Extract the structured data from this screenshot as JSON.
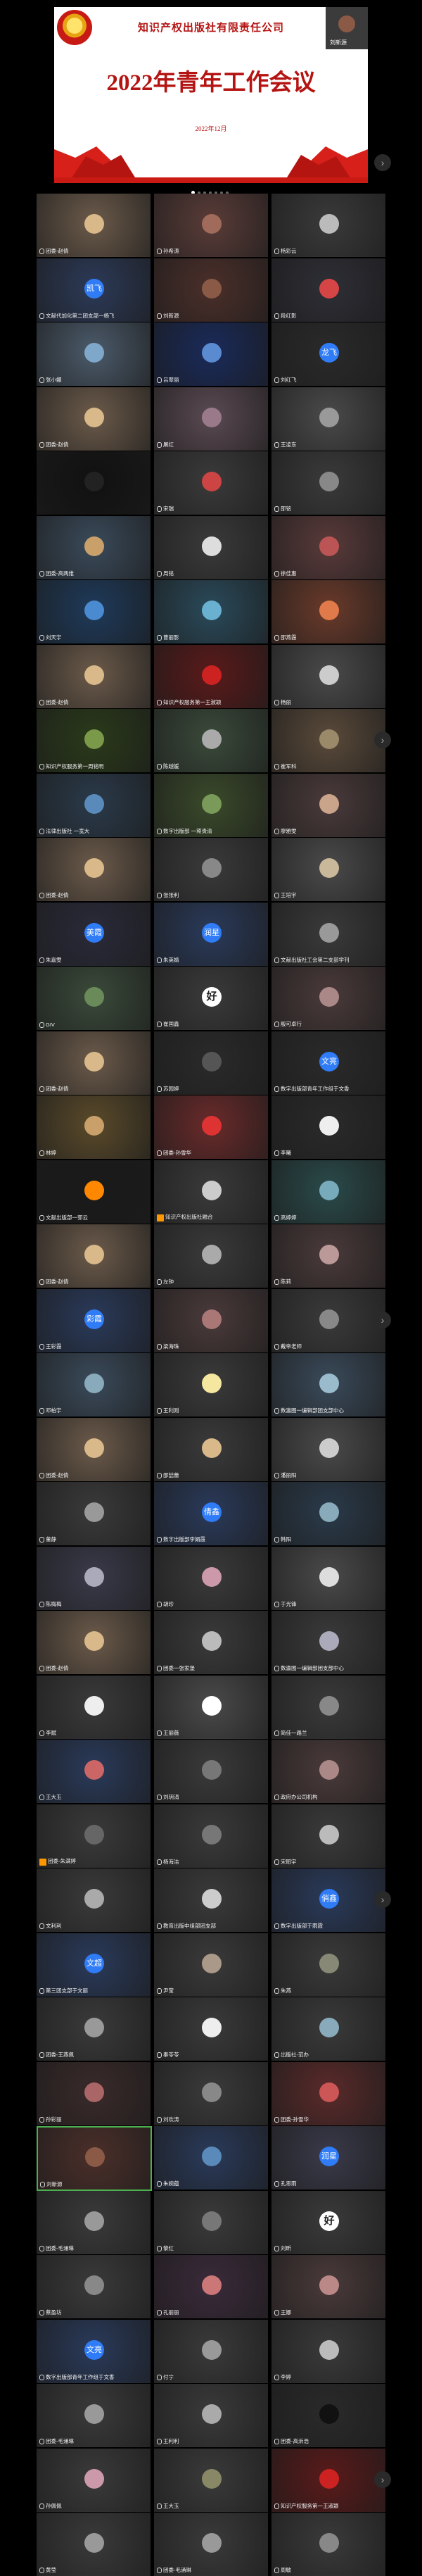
{
  "shared_screen": {
    "org": "知识产权出版社有限责任公司",
    "title": "2022年青年工作会议",
    "date": "2022年12月",
    "self_name": "刘新源"
  },
  "nav_arrow": "›",
  "tiles": [
    {
      "name": "团委-赵倩",
      "color": "#6b5a4a",
      "av": "#d9b98a"
    },
    {
      "name": "孙希涛",
      "color": "#5a3c38",
      "av": "#a06b5a"
    },
    {
      "name": "杨彩云",
      "color": "#3a3a3a",
      "av": "#bbb"
    },
    {
      "name": "文献代加化第二团支部一杨飞",
      "color": "#2c3a58",
      "badge": "凯飞"
    },
    {
      "name": "刘新源",
      "color": "#4b2f2a",
      "av": "#8a5a46"
    },
    {
      "name": "段红影",
      "color": "#2e2e36",
      "av": "#d64545"
    },
    {
      "name": "张小娜",
      "color": "#4b5a6a",
      "av": "#7fa7c9"
    },
    {
      "name": "吕翠丽",
      "color": "#1a2a5a",
      "av": "#5a8ad0"
    },
    {
      "name": "刘红飞",
      "color": "#2a2a2a",
      "badge": "龙飞"
    },
    {
      "name": "团委-赵倩",
      "color": "#6b5a4a",
      "av": "#d9b98a"
    },
    {
      "name": "屠红",
      "color": "#5a4a52",
      "av": "#9a7a8a"
    },
    {
      "name": "王凌东",
      "color": "#4a4a4a",
      "av": "#999"
    },
    {
      "name": "",
      "color": "#111",
      "av": "#222"
    },
    {
      "name": "宋瑞",
      "color": "#3a3a3a",
      "av": "#c44"
    },
    {
      "name": "邵铭",
      "color": "#3a3a3a",
      "av": "#888"
    },
    {
      "name": "团委-高两维",
      "color": "#3a4a5a",
      "av": "#c9a06a"
    },
    {
      "name": "周铭",
      "color": "#3a3a3a",
      "av": "#ddd"
    },
    {
      "name": "徐佳惠",
      "color": "#5a3a3a",
      "av": "#b55"
    },
    {
      "name": "刘天宇",
      "color": "#1e3a5a",
      "av": "#4a8ad0"
    },
    {
      "name": "曹丽影",
      "color": "#2a4a5a",
      "av": "#6ab0d0"
    },
    {
      "name": "邵燕霞",
      "color": "#6a3a2a",
      "av": "#e07a4a"
    },
    {
      "name": "团委-赵倩",
      "color": "#6b5a4a",
      "av": "#d9b98a"
    },
    {
      "name": "知识产权服务第一王淑颖",
      "color": "#5a1a1a",
      "av": "#c22"
    },
    {
      "name": "杨丽",
      "color": "#4a4a4a",
      "av": "#ccc"
    },
    {
      "name": "知识产权服务第一周铭明",
      "color": "#2a3a1a",
      "av": "#7a9a4a"
    },
    {
      "name": "陈越媛",
      "color": "#3a4a3a",
      "av": "#aaa"
    },
    {
      "name": "崔军科",
      "color": "#5a4a3a",
      "av": "#9a8a6a"
    },
    {
      "name": "法律出版社 一宽大",
      "color": "#2a3a4a",
      "av": "#5a8aba"
    },
    {
      "name": "数字出版部 一蒋贵清",
      "color": "#3a4a2a",
      "av": "#7a9a5a"
    },
    {
      "name": "廖雅雯",
      "color": "#4a3a3a",
      "av": "#c9a38a"
    },
    {
      "name": "团委-赵倩",
      "color": "#6b5a4a",
      "av": "#d9b98a"
    },
    {
      "name": "张张利",
      "color": "#3a3a3a",
      "av": "#888"
    },
    {
      "name": "王培宇",
      "color": "#4a4a4a",
      "av": "#c9b89a"
    },
    {
      "name": "朱嘉雯",
      "color": "#2a2a3a",
      "badge": "美霞"
    },
    {
      "name": "朱英婧",
      "color": "#2a3a5a",
      "badge": "润星"
    },
    {
      "name": "文献出版社工会第二支部学刊",
      "color": "#3a3a3a",
      "av": "#999"
    },
    {
      "name": "GIV",
      "color": "#3a4a3a",
      "av": "#6a8a5a"
    },
    {
      "name": "崔国鑫",
      "color": "#3a3a3a",
      "text": "好"
    },
    {
      "name": "殷可卓行",
      "color": "#4a3a3a",
      "av": "#a88"
    },
    {
      "name": "团委-赵倩",
      "color": "#6b5a4a",
      "av": "#d9b98a"
    },
    {
      "name": "苏园婷",
      "color": "#2a2a2a",
      "av": "#555"
    },
    {
      "name": "数字出版部青年工作组于文香",
      "color": "#2a2a2a",
      "badge": "文亮"
    },
    {
      "name": "林婷",
      "color": "#5a4a2a",
      "av": "#c9a06a"
    },
    {
      "name": "团委-孙雪华",
      "color": "#6a2a2a",
      "av": "#d33"
    },
    {
      "name": "李曦",
      "color": "#2a2a2a",
      "av": "#eee"
    },
    {
      "name": "文献出版部一郭云",
      "color": "#1a1a1a",
      "av": "#f80"
    },
    {
      "name": "知识产权出版社融合",
      "color": "#3a3a3a",
      "av": "#ccc",
      "host": true
    },
    {
      "name": "高婷婷",
      "color": "#2a4a4a",
      "av": "#7ab"
    },
    {
      "name": "团委-赵倩",
      "color": "#6b5a4a",
      "av": "#d9b98a"
    },
    {
      "name": "左钟",
      "color": "#3a3a3a",
      "av": "#aaa"
    },
    {
      "name": "陈莉",
      "color": "#4a3a3a",
      "av": "#b99"
    },
    {
      "name": "王彩霞",
      "color": "#2a3a5a",
      "badge": "彩霞"
    },
    {
      "name": "梁海珠",
      "color": "#4a3a3a",
      "av": "#a77"
    },
    {
      "name": "戴帝老师",
      "color": "#3a3a3a",
      "av": "#888"
    },
    {
      "name": "邓柏宇",
      "color": "#3a4a5a",
      "av": "#8ab"
    },
    {
      "name": "王利则",
      "color": "#3a3a3a",
      "av": "#f5e6a0"
    },
    {
      "name": "数瀛图一编辑部团支部中心",
      "color": "#3a4a5a",
      "av": "#9bc"
    },
    {
      "name": "团委-赵倩",
      "color": "#6b5a4a",
      "av": "#d9b98a"
    },
    {
      "name": "邵喆蕾",
      "color": "#3a3a3a",
      "av": "#d9b98a"
    },
    {
      "name": "潘丽阳",
      "color": "#4a4a4a",
      "av": "#ccc"
    },
    {
      "name": "董静",
      "color": "#3a3a3a",
      "av": "#999"
    },
    {
      "name": "数字出版部李娟霞",
      "color": "#2a3a5a",
      "badge": "倩鑫"
    },
    {
      "name": "韩阳",
      "color": "#2a3a4a",
      "av": "#8ab"
    },
    {
      "name": "陈梅梅",
      "color": "#3a3a4a",
      "av": "#aab"
    },
    {
      "name": "胡珍",
      "color": "#3a3a3a",
      "av": "#c9a"
    },
    {
      "name": "于光锋",
      "color": "#4a4a4a",
      "av": "#ddd"
    },
    {
      "name": "团委-赵倩",
      "color": "#6b5a4a",
      "av": "#d9b98a"
    },
    {
      "name": "团委一张家堡",
      "color": "#3a3a3a",
      "av": "#bbb"
    },
    {
      "name": "数瀛图一编辑部团支部中心",
      "color": "#3a3a3a",
      "av": "#aab"
    },
    {
      "name": "李赋",
      "color": "#3a3a3a",
      "av": "#eee"
    },
    {
      "name": "王丽薇",
      "color": "#4a4a4a",
      "av": "#fff"
    },
    {
      "name": "简佳一路兰",
      "color": "#3a3a3a",
      "av": "#888"
    },
    {
      "name": "王大玉",
      "color": "#2a3a5a",
      "av": "#c66"
    },
    {
      "name": "刘玥涓",
      "color": "#3a3a3a",
      "av": "#777"
    },
    {
      "name": "政府办公司机构",
      "color": "#4a3a3a",
      "av": "#a88"
    },
    {
      "name": "团委-朱满婷",
      "color": "#3a3a3a",
      "av": "#666",
      "host": true
    },
    {
      "name": "杨海洁",
      "color": "#3a3a3a",
      "av": "#777"
    },
    {
      "name": "宋昭宇",
      "color": "#3a3a3a",
      "av": "#bbb"
    },
    {
      "name": "文利利",
      "color": "#3a3a3a",
      "av": "#aaa"
    },
    {
      "name": "教育出版中组部团支部",
      "color": "#3a3a3a",
      "av": "#ccc"
    },
    {
      "name": "数字出版部于雨霞",
      "color": "#2a3a5a",
      "badge": "俏鑫"
    },
    {
      "name": "第三团支部于文丽",
      "color": "#2a3a5a",
      "badge": "文超"
    },
    {
      "name": "尹莹",
      "color": "#3a3a3a",
      "av": "#a98"
    },
    {
      "name": "朱燕",
      "color": "#3a3a3a",
      "av": "#887"
    },
    {
      "name": "团委-王燕佩",
      "color": "#3a3a3a",
      "av": "#999"
    },
    {
      "name": "秦苓苓",
      "color": "#3a3a3a",
      "av": "#eee"
    },
    {
      "name": "出版社-范办",
      "color": "#3a3a3a",
      "av": "#8ab"
    },
    {
      "name": "孙彩丽",
      "color": "#3a2a2a",
      "av": "#a66"
    },
    {
      "name": "刘欢涛",
      "color": "#3a3a3a",
      "av": "#888"
    },
    {
      "name": "团委-孙雪华",
      "color": "#5a2a2a",
      "av": "#c55"
    },
    {
      "name": "刘新源",
      "color": "#4b2f2a",
      "av": "#8a5a46",
      "active": true
    },
    {
      "name": "朱婉蕴",
      "color": "#2a3a5a",
      "av": "#5a8aba"
    },
    {
      "name": "孔思雨",
      "color": "#3a3a4a",
      "badge": "润星"
    },
    {
      "name": "团委-毛涌琳",
      "color": "#3a3a3a",
      "av": "#999"
    },
    {
      "name": "黎红",
      "color": "#3a3a3a",
      "av": "#777"
    },
    {
      "name": "刘昕",
      "color": "#3a3a3a",
      "text": "好"
    },
    {
      "name": "蔡盈坊",
      "color": "#3a3a3a",
      "av": "#888"
    },
    {
      "name": "孔丽丽",
      "color": "#3a2a3a",
      "av": "#c77"
    },
    {
      "name": "王娜",
      "color": "#4a3a3a",
      "av": "#b88"
    },
    {
      "name": "数字出版部青年工作组于文香",
      "color": "#2a3a5a",
      "badge": "文亮"
    },
    {
      "name": "付宁",
      "color": "#3a3a3a",
      "av": "#999"
    },
    {
      "name": "李婷",
      "color": "#3a3a3a",
      "av": "#bbb"
    },
    {
      "name": "团委-毛涌琳",
      "color": "#3a3a3a",
      "av": "#999"
    },
    {
      "name": "王利利",
      "color": "#3a3a3a",
      "av": "#aaa"
    },
    {
      "name": "团委-高浜浩",
      "color": "#2a2a2a",
      "av": "#111"
    },
    {
      "name": "孙佩佩",
      "color": "#3a3a3a",
      "av": "#c9a"
    },
    {
      "name": "王大玉",
      "color": "#3a3a3a",
      "av": "#886"
    },
    {
      "name": "知识产权服务第一王淑颖",
      "color": "#5a1a1a",
      "av": "#c22"
    },
    {
      "name": "黄莹",
      "color": "#3a3a3a",
      "av": "#999"
    },
    {
      "name": "团委-毛涌琳",
      "color": "#3a3a3a",
      "av": "#999"
    },
    {
      "name": "周敏",
      "color": "#3a3a3a",
      "av": "#888"
    }
  ]
}
